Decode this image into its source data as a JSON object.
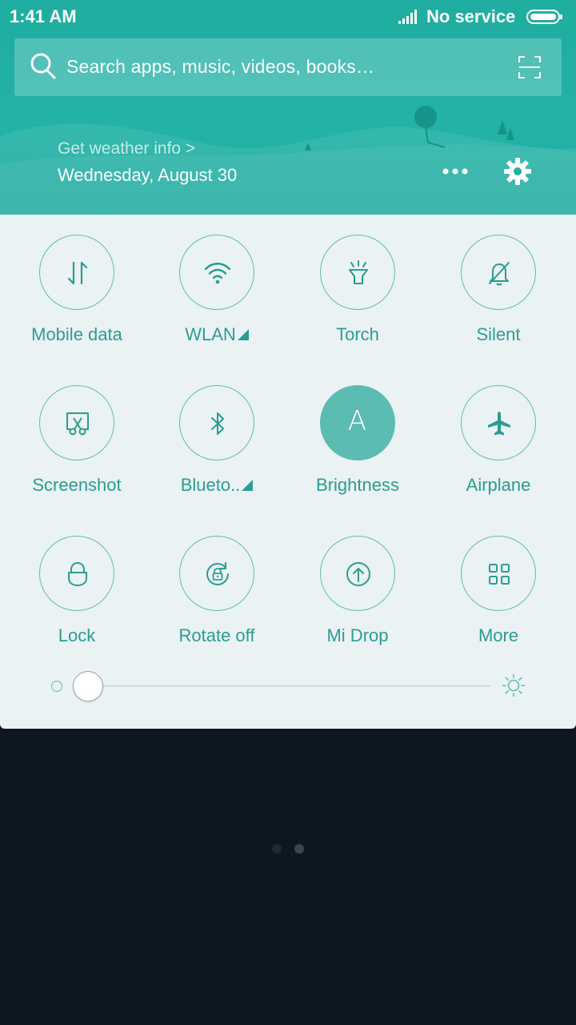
{
  "status": {
    "time": "1:41 AM",
    "service": "No service",
    "signal_icon": "signal-icon",
    "battery_icon": "battery-icon"
  },
  "search": {
    "placeholder": "Search apps, music, videos, books…"
  },
  "weather": {
    "link": "Get weather info >",
    "date": "Wednesday, August 30"
  },
  "toggles": [
    {
      "label": "Mobile data",
      "icon": "mobile-data-icon",
      "active": false,
      "expandable": false
    },
    {
      "label": "WLAN",
      "icon": "wifi-icon",
      "active": false,
      "expandable": true
    },
    {
      "label": "Torch",
      "icon": "torch-icon",
      "active": false,
      "expandable": false
    },
    {
      "label": "Silent",
      "icon": "bell-off-icon",
      "active": false,
      "expandable": false
    },
    {
      "label": "Screenshot",
      "icon": "screenshot-icon",
      "active": false,
      "expandable": false
    },
    {
      "label": "Blueto..",
      "icon": "bluetooth-icon",
      "active": false,
      "expandable": true
    },
    {
      "label": "Brightness",
      "icon": "brightness-auto-icon",
      "glyph": "A",
      "active": true,
      "expandable": false
    },
    {
      "label": "Airplane",
      "icon": "airplane-icon",
      "active": false,
      "expandable": false
    },
    {
      "label": "Lock",
      "icon": "lock-icon",
      "active": false,
      "expandable": false
    },
    {
      "label": "Rotate off",
      "icon": "rotate-lock-icon",
      "active": false,
      "expandable": false
    },
    {
      "label": "Mi Drop",
      "icon": "mi-drop-icon",
      "active": false,
      "expandable": false
    },
    {
      "label": "More",
      "icon": "grid-icon",
      "active": false,
      "expandable": false
    }
  ],
  "brightness_slider": {
    "level": 0.0
  },
  "pager": {
    "count": 2,
    "current": 1
  },
  "colors": {
    "accent": "#2a9d93",
    "active_fill": "#5bbcb2",
    "header": "#20ab9f",
    "background": "#0d181e"
  }
}
